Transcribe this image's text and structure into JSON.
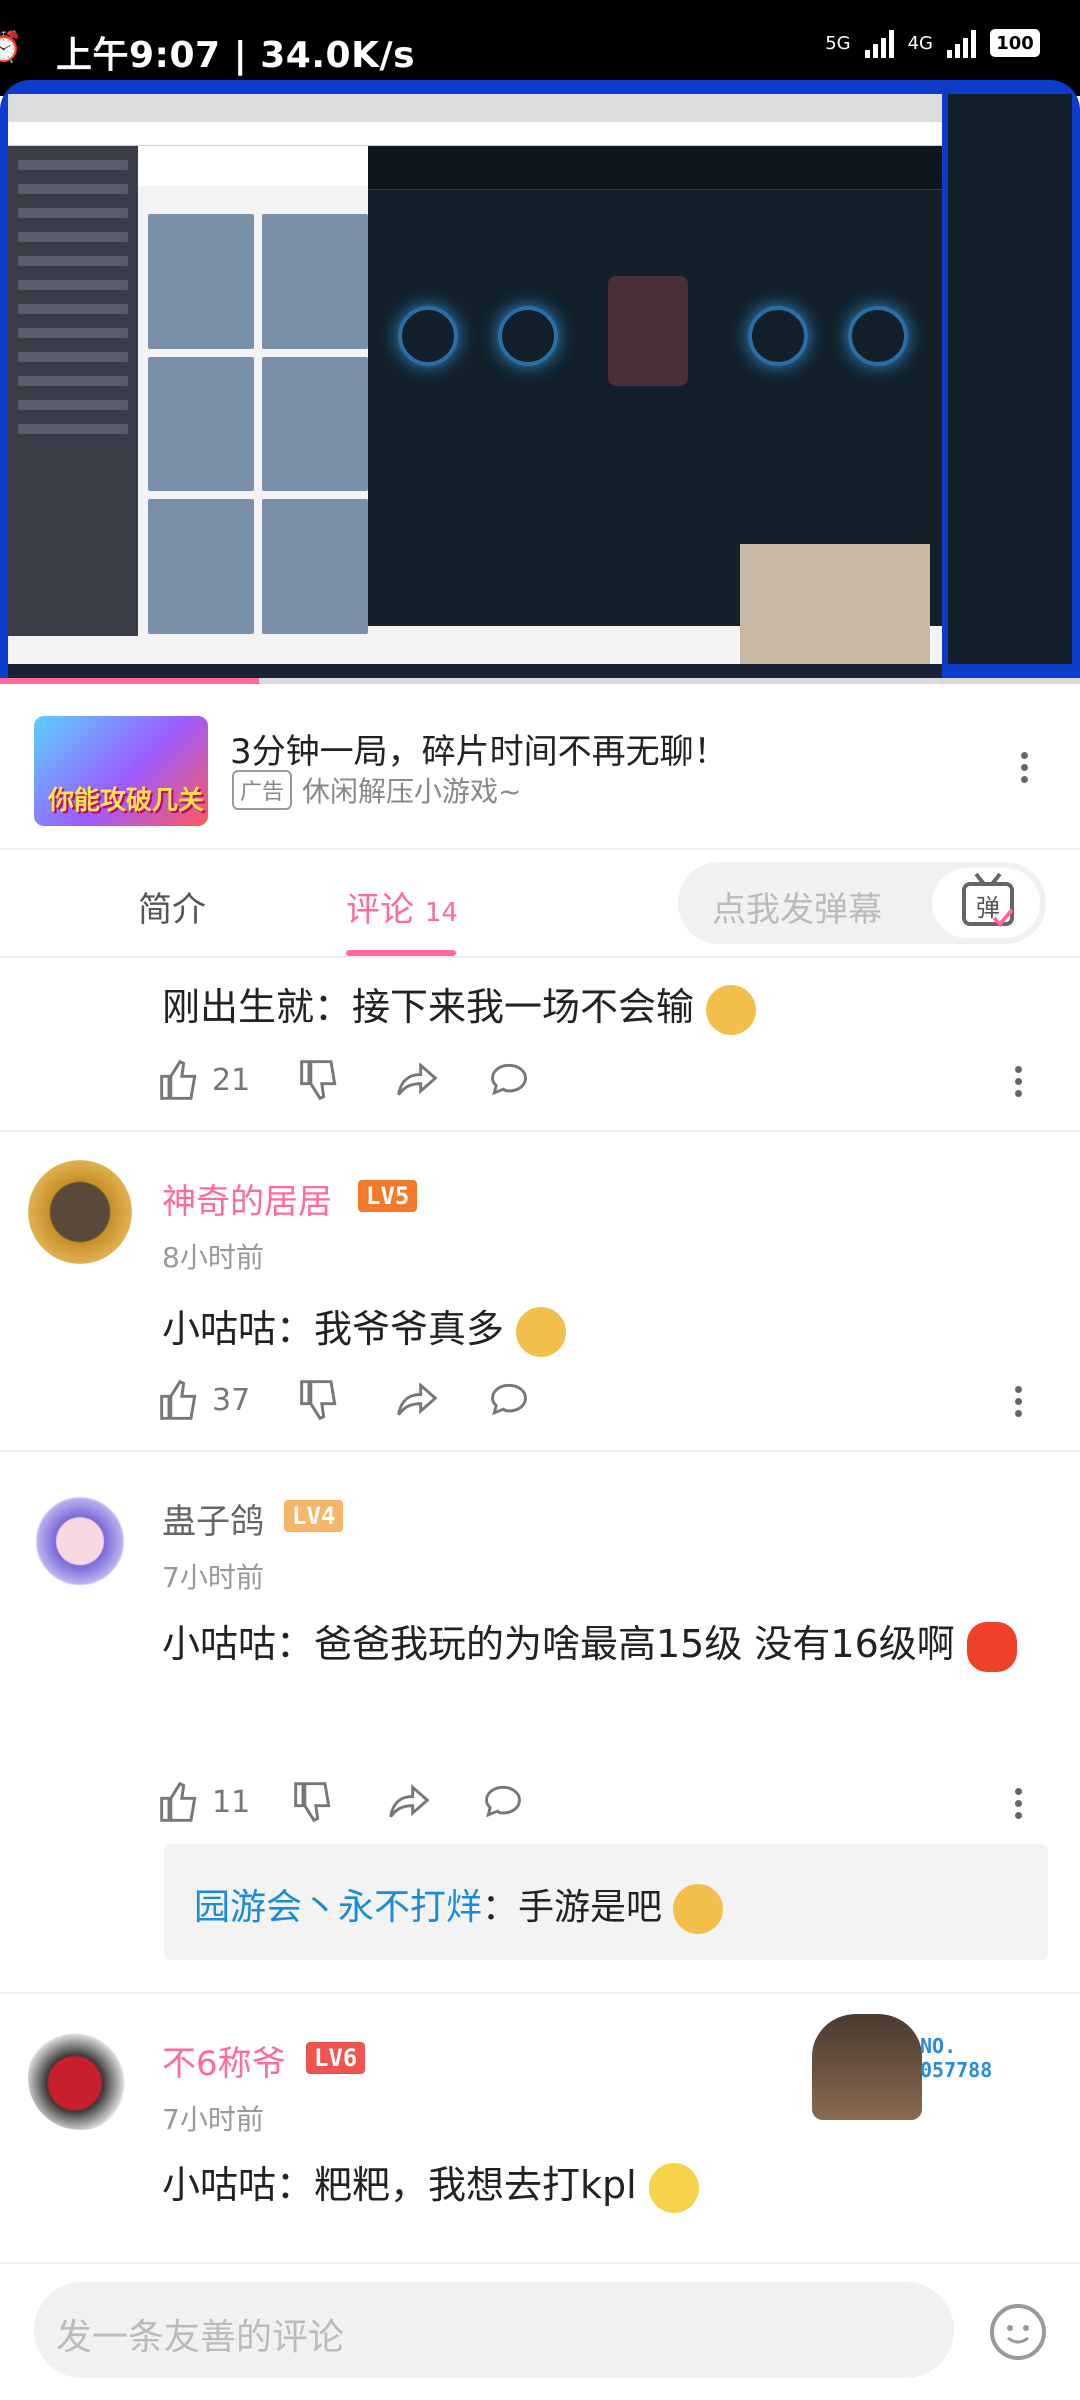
{
  "status_bar": {
    "time": "上午9:07 | 34.0K/s",
    "network_1": "5G",
    "network_2": "4G",
    "battery": "100"
  },
  "video": {
    "progress_fraction": 0.24
  },
  "ad": {
    "title": "3分钟一局，碎片时间不再无聊！",
    "tag": "广告",
    "source": "休闲解压小游戏~",
    "thumb_text": "你能攻破几关"
  },
  "tabs": {
    "intro": "简介",
    "comments": "评论",
    "comment_count": "14",
    "danmu_placeholder": "点我发弹幕",
    "danmu_button": "弹"
  },
  "comments": [
    {
      "text": "刚出生就：接下来我一场不会输",
      "likes": "21"
    },
    {
      "user": "神奇的居居",
      "level": "LV5",
      "time": "8小时前",
      "text": "小咕咕：我爷爷真多",
      "likes": "37"
    },
    {
      "user": "蛊子鸽",
      "level": "LV4",
      "time": "7小时前",
      "text": "小咕咕：爸爸我玩的为啥最高15级 没有16级啊",
      "likes": "11",
      "reply": {
        "user": "园游会丶永不打烊",
        "text": "：手游是吧"
      }
    },
    {
      "user": "不6称爷",
      "level": "LV6",
      "time": "7小时前",
      "text": "小咕咕：粑粑，我想去打kpl",
      "badge_text": "NO.\n057788"
    }
  ],
  "bottom": {
    "placeholder": "发一条友善的评论"
  },
  "colors": {
    "accent": "#ff6b9a",
    "link": "#1a8bd8",
    "lv5": "#f27b2b",
    "lv4": "#f5b56b",
    "lv6": "#f0544f"
  }
}
